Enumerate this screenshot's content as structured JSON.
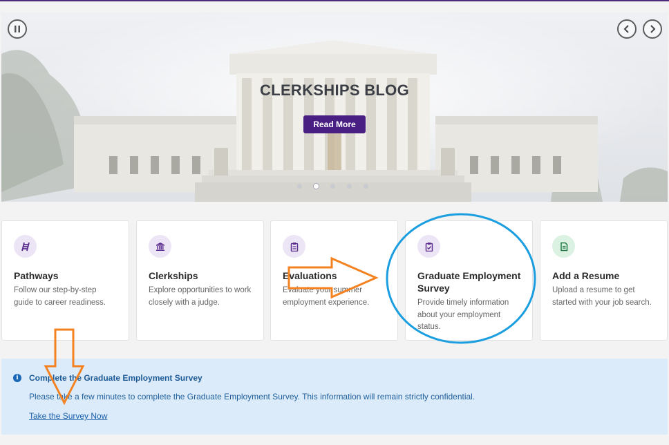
{
  "hero": {
    "title": "CLERKSHIPS BLOG",
    "button_label": "Read More",
    "active_slide": 2,
    "slide_count": 5
  },
  "cards": [
    {
      "title": "Pathways",
      "desc": "Follow our step-by-step guide to career readiness.",
      "icon": "ladder-icon"
    },
    {
      "title": "Clerkships",
      "desc": "Explore opportunities to work closely with a judge.",
      "icon": "courthouse-icon"
    },
    {
      "title": "Evaluations",
      "desc": "Evaluate your summer employment experience.",
      "icon": "clipboard-icon"
    },
    {
      "title": "Graduate Employment Survey",
      "desc": "Provide timely information about your employment status.",
      "icon": "clipboard-check-icon"
    },
    {
      "title": "Add a Resume",
      "desc": "Upload a resume to get started with your job search.",
      "icon": "document-icon"
    }
  ],
  "alert": {
    "title": "Complete the Graduate Employment Survey",
    "message": "Please take a few minutes to complete the Graduate Employment Survey. This information will remain strictly confidential.",
    "link": "Take the Survey Now",
    "info_glyph": "i"
  },
  "colors": {
    "brand_purple": "#4a1f83",
    "annotation_orange": "#f58220",
    "annotation_blue": "#1a9ee0",
    "alert_bg": "#dcebf9"
  }
}
